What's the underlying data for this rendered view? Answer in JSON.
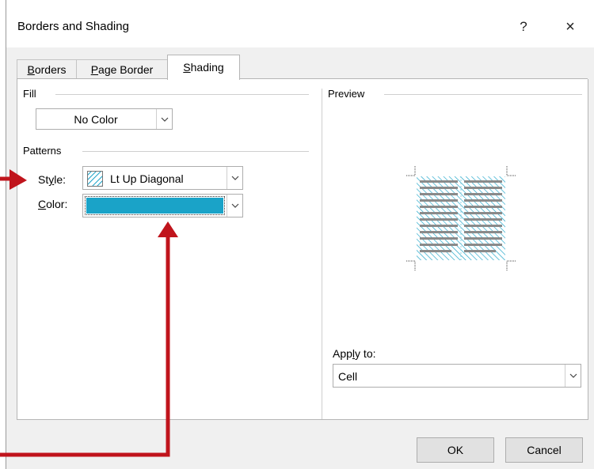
{
  "dialog": {
    "title": "Borders and Shading",
    "help_glyph": "?",
    "close_glyph": "×"
  },
  "tabs": [
    {
      "label": "Borders",
      "active": false
    },
    {
      "label": "Page Border",
      "active": false
    },
    {
      "label": "Shading",
      "active": true
    }
  ],
  "fill": {
    "group_label": "Fill",
    "value": "No Color"
  },
  "patterns": {
    "group_label": "Patterns",
    "style_label": "Style:",
    "style_value": "Lt Up Diagonal",
    "color_label": "Color:",
    "color_value": "#1aa3c8"
  },
  "preview": {
    "group_label": "Preview",
    "pattern_color": "#1aa3c8"
  },
  "apply_to": {
    "label": "Apply to:",
    "value": "Cell"
  },
  "buttons": {
    "ok": "OK",
    "cancel": "Cancel"
  },
  "annotation": {
    "arrow_color": "#c0141c"
  },
  "icons": {
    "dropdown": "chevron-down-icon",
    "help": "help-icon",
    "close": "close-icon"
  }
}
